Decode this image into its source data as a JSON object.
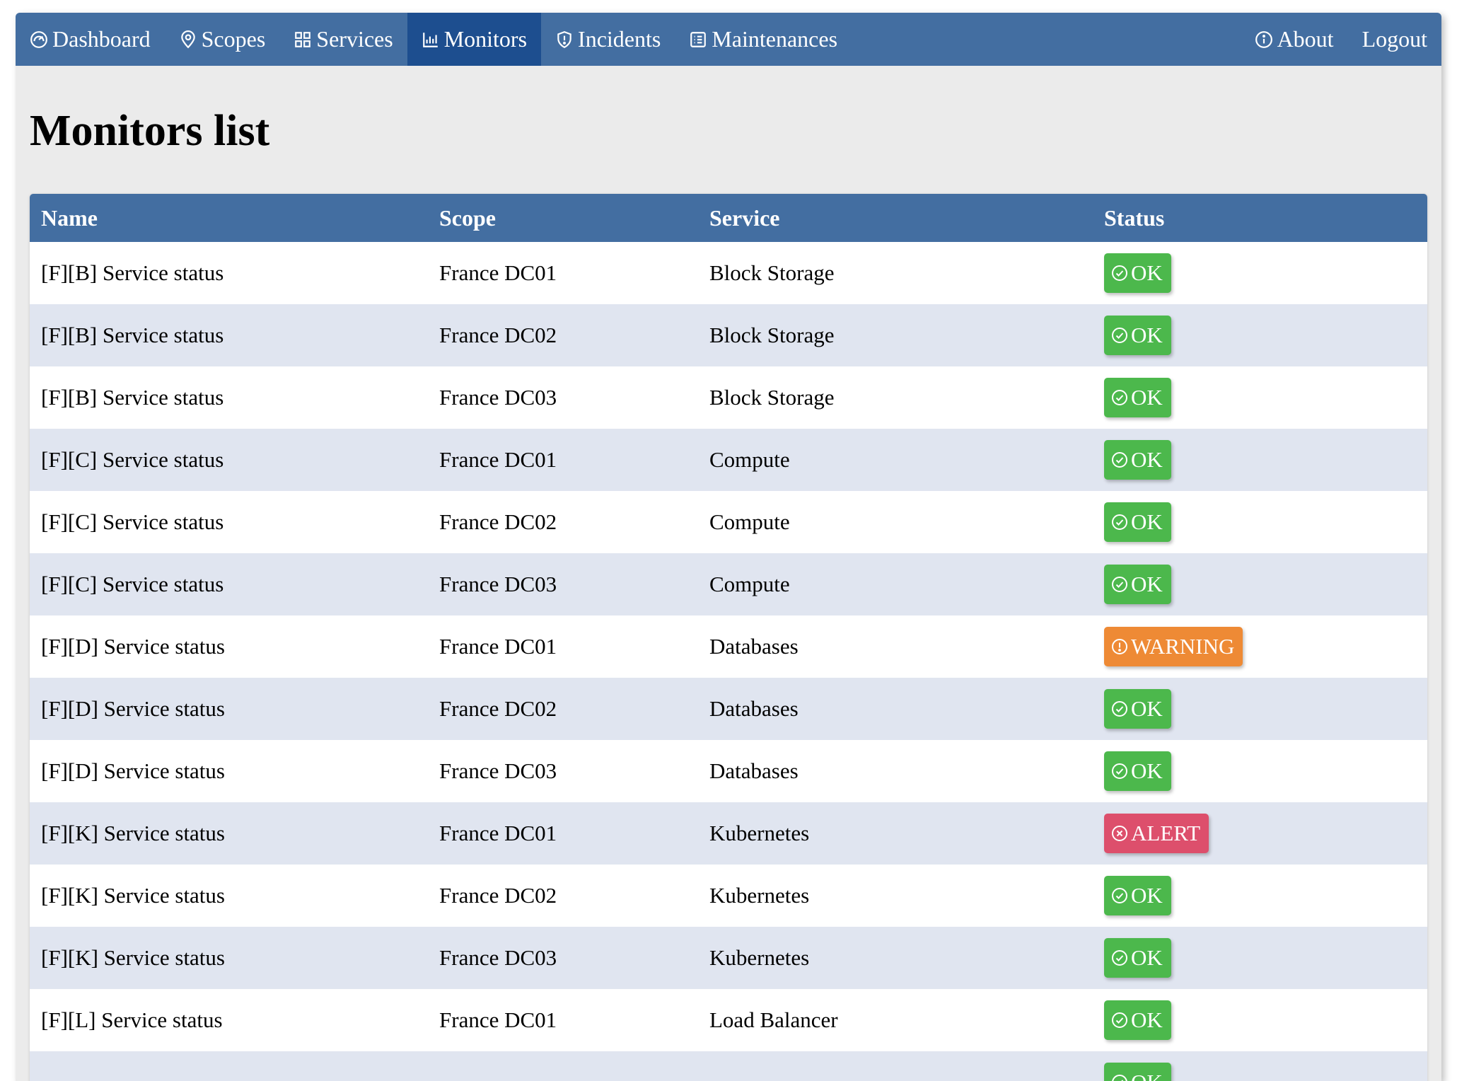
{
  "nav": {
    "items": [
      {
        "label": "Dashboard",
        "icon": "dashboard-gauge-icon"
      },
      {
        "label": "Scopes",
        "icon": "location-pin-icon"
      },
      {
        "label": "Services",
        "icon": "grid-icon"
      },
      {
        "label": "Monitors",
        "icon": "bar-chart-icon",
        "active": true
      },
      {
        "label": "Incidents",
        "icon": "shield-alert-icon"
      },
      {
        "label": "Maintenances",
        "icon": "list-icon"
      }
    ],
    "right": [
      {
        "label": "About",
        "icon": "info-icon"
      },
      {
        "label": "Logout"
      }
    ]
  },
  "page": {
    "title": "Monitors list"
  },
  "table": {
    "headers": [
      "Name",
      "Scope",
      "Service",
      "Status"
    ],
    "rows": [
      {
        "name": "[F][B] Service status",
        "scope": "France DC01",
        "service": "Block Storage",
        "status": "OK"
      },
      {
        "name": "[F][B] Service status",
        "scope": "France DC02",
        "service": "Block Storage",
        "status": "OK"
      },
      {
        "name": "[F][B] Service status",
        "scope": "France DC03",
        "service": "Block Storage",
        "status": "OK"
      },
      {
        "name": "[F][C] Service status",
        "scope": "France DC01",
        "service": "Compute",
        "status": "OK"
      },
      {
        "name": "[F][C] Service status",
        "scope": "France DC02",
        "service": "Compute",
        "status": "OK"
      },
      {
        "name": "[F][C] Service status",
        "scope": "France DC03",
        "service": "Compute",
        "status": "OK"
      },
      {
        "name": "[F][D] Service status",
        "scope": "France DC01",
        "service": "Databases",
        "status": "WARNING"
      },
      {
        "name": "[F][D] Service status",
        "scope": "France DC02",
        "service": "Databases",
        "status": "OK"
      },
      {
        "name": "[F][D] Service status",
        "scope": "France DC03",
        "service": "Databases",
        "status": "OK"
      },
      {
        "name": "[F][K] Service status",
        "scope": "France DC01",
        "service": "Kubernetes",
        "status": "ALERT"
      },
      {
        "name": "[F][K] Service status",
        "scope": "France DC02",
        "service": "Kubernetes",
        "status": "OK"
      },
      {
        "name": "[F][K] Service status",
        "scope": "France DC03",
        "service": "Kubernetes",
        "status": "OK"
      },
      {
        "name": "[F][L] Service status",
        "scope": "France DC01",
        "service": "Load Balancer",
        "status": "OK"
      },
      {
        "name": "",
        "scope": "",
        "service": "",
        "status": "OK"
      }
    ]
  },
  "colors": {
    "navbar": "#436ea1",
    "nav_active": "#1d4e8f",
    "ok": "#4cb84c",
    "warning": "#ee8a35",
    "alert": "#dd4f6c",
    "row_alt": "#e0e5f0"
  }
}
